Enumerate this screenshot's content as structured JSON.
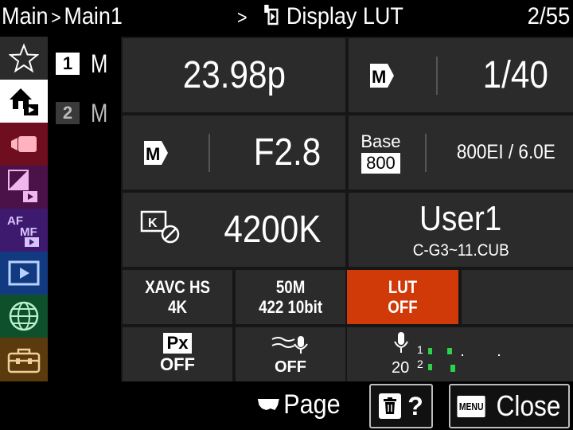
{
  "header": {
    "crumb1": "Main",
    "crumb2": "Main1",
    "separator": ">",
    "chevron": ">",
    "title": "Display LUT",
    "title_icon": "display-lut-icon",
    "page": "2/55"
  },
  "sidebar": {
    "tabs": [
      {
        "name": "my-menu",
        "icon": "star-icon",
        "color": "#2b2b2b"
      },
      {
        "name": "main",
        "icon": "home-icon",
        "color": "#ffffff",
        "selected": true
      },
      {
        "name": "shooting",
        "icon": "movie-camera-icon",
        "color": "#6e0e1e"
      },
      {
        "name": "exposure-color",
        "icon": "exposure-icon",
        "color": "#4a1248"
      },
      {
        "name": "focus",
        "icon": "af-mf-icon",
        "color": "#3e1a6e"
      },
      {
        "name": "playback",
        "icon": "playback-icon",
        "color": "#123a80"
      },
      {
        "name": "network",
        "icon": "globe-icon",
        "color": "#0e4f2c"
      },
      {
        "name": "setup",
        "icon": "toolbox-icon",
        "color": "#5b3b0e"
      }
    ]
  },
  "sublist": [
    {
      "num": "1",
      "letter": "M",
      "active": true
    },
    {
      "num": "2",
      "letter": "M",
      "active": false
    }
  ],
  "grid": {
    "frame_rate": "23.98p",
    "shutter_mode": "M",
    "shutter": "1/40",
    "aperture_mode": "M",
    "aperture": "F2.8",
    "base_label": "Base",
    "base_value": "800",
    "ei": "800EI / 6.0E",
    "wb_icon": "wb-kelvin-lock-icon",
    "wb": "4200K",
    "lut_name": "User1",
    "lut_file": "C-G3~11.CUB",
    "format_line1": "XAVC HS",
    "format_line2": "4K",
    "bitrate_line1": "50M",
    "bitrate_line2": "422 10bit",
    "lut_line1": "LUT",
    "lut_line2": "OFF",
    "lut_color": "#d03a09",
    "px_label": "Px",
    "px_value": "OFF",
    "wind_value": "OFF",
    "audio_level": "20",
    "audio_ch1": "1",
    "audio_ch2": "2"
  },
  "footer": {
    "page_label": "Page",
    "help_label": "?",
    "menu_label": "MENU",
    "close_label": "Close"
  }
}
